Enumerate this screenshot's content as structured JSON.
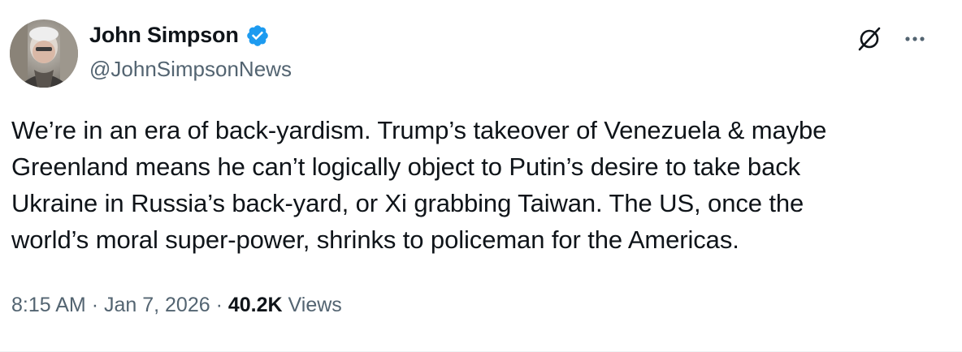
{
  "author": {
    "display_name": "John Simpson",
    "handle": "@JohnSimpsonNews",
    "verified": true,
    "verified_color": "#1d9bf0"
  },
  "tweet": {
    "lines": [
      "We’re in an era of back-yardism. Trump’s takeover of Venezuela & maybe",
      "Greenland means he can’t logically object to Putin’s desire to take back",
      "Ukraine in Russia’s back-yard, or Xi grabbing Taiwan. The US, once the",
      "world’s moral super-power, shrinks to policeman for the Americas."
    ],
    "time": "8:15 AM",
    "separator": "·",
    "date": "Jan 7, 2026",
    "views_count": "40.2K",
    "views_label": "Views"
  },
  "icons": {
    "grok": "grok-icon",
    "more": "more-icon",
    "verified": "verified-badge-icon"
  },
  "colors": {
    "text_primary": "#0f1419",
    "text_secondary": "#536471"
  }
}
